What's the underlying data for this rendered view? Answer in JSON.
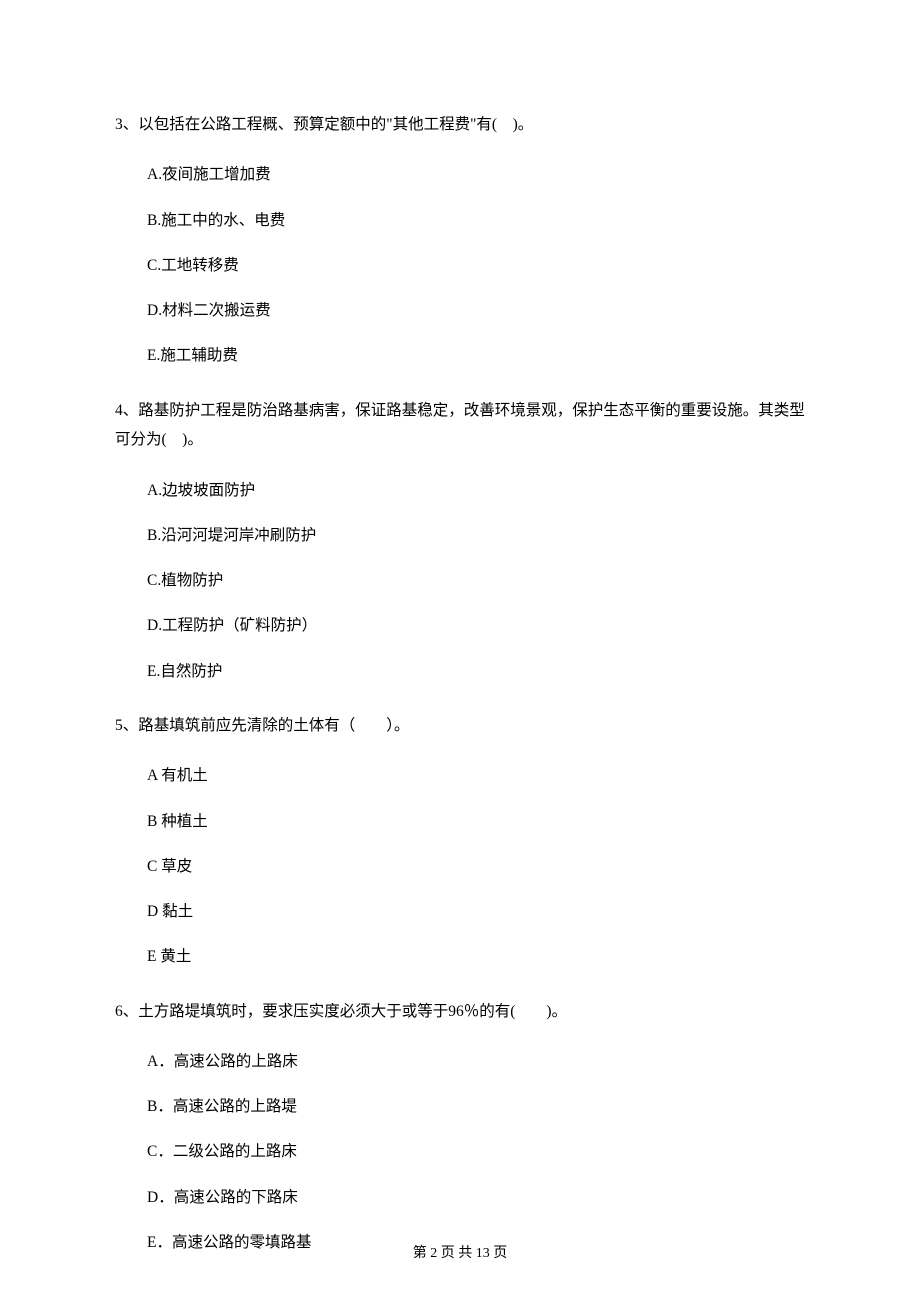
{
  "questions": [
    {
      "stem": "3、以包括在公路工程概、预算定额中的\"其他工程费\"有(　)。",
      "options": [
        "A.夜间施工增加费",
        "B.施工中的水、电费",
        "C.工地转移费",
        "D.材料二次搬运费",
        "E.施工辅助费"
      ]
    },
    {
      "stem": "4、路基防护工程是防治路基病害，保证路基稳定，改善环境景观，保护生态平衡的重要设施。其类型可分为(　)。",
      "options": [
        "A.边坡坡面防护",
        "B.沿河河堤河岸冲刷防护",
        "C.植物防护",
        "D.工程防护（矿料防护）",
        "E.自然防护"
      ]
    },
    {
      "stem": "5、路基填筑前应先清除的土体有（　　）。",
      "options": [
        "A 有机土",
        "B 种植土",
        "C 草皮",
        "D 黏土",
        "E 黄土"
      ]
    },
    {
      "stem": "6、土方路堤填筑时，要求压实度必须大于或等于96％的有(　　)。",
      "options": [
        "A．高速公路的上路床",
        "B．高速公路的上路堤",
        "C．二级公路的上路床",
        "D．高速公路的下路床",
        "E．高速公路的零填路基"
      ]
    }
  ],
  "footer": "第 2 页 共 13 页"
}
